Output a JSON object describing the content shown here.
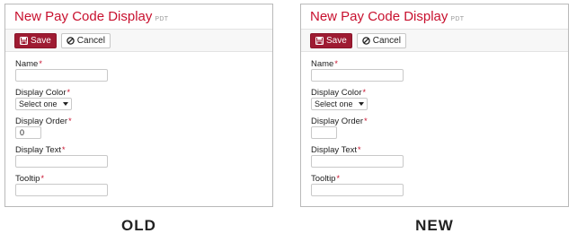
{
  "panels": [
    {
      "title": "New Pay Code Display",
      "timezone": "PDT",
      "save_label": "Save",
      "cancel_label": "Cancel",
      "fields": {
        "name_label": "Name",
        "color_label": "Display Color",
        "color_value": "Select one",
        "order_label": "Display Order",
        "order_value": "0",
        "text_label": "Display Text",
        "tooltip_label": "Tooltip"
      },
      "caption": "OLD"
    },
    {
      "title": "New Pay Code Display",
      "timezone": "PDT",
      "save_label": "Save",
      "cancel_label": "Cancel",
      "fields": {
        "name_label": "Name",
        "color_label": "Display Color",
        "color_value": "Select one",
        "order_label": "Display Order",
        "order_value": "",
        "text_label": "Display Text",
        "tooltip_label": "Tooltip"
      },
      "caption": "NEW"
    }
  ],
  "required_marker": "*",
  "colors": {
    "title": "#c8102e",
    "save_button": "#9e1b32",
    "required": "#c8102e"
  },
  "icons": {
    "save": "floppy-disk-icon",
    "cancel": "ban-circle-icon"
  }
}
